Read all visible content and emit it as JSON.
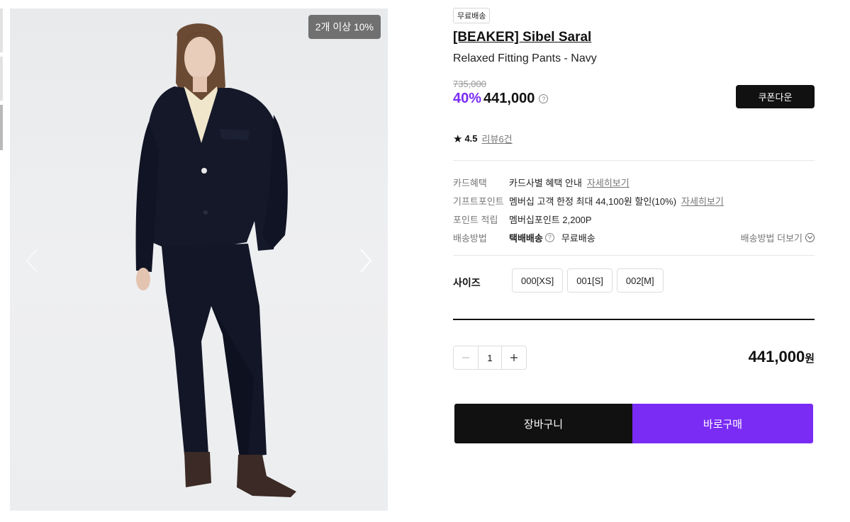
{
  "gallery": {
    "badge": "2개 이상 10%",
    "prev_icon": "chevron-left-icon",
    "next_icon": "chevron-right-icon"
  },
  "product": {
    "tag": "무료배송",
    "brand": "[BEAKER] Sibel Saral",
    "name": "Relaxed Fitting Pants - Navy",
    "original_price": "735,000",
    "discount_rate": "40%",
    "sale_price": "441,000",
    "coupon_button": "쿠폰다운",
    "rating": "4.5",
    "review_link": "리뷰6건"
  },
  "info": {
    "card": {
      "label": "카드혜택",
      "value": "카드사별 혜택 안내",
      "link": "자세히보기"
    },
    "gift": {
      "label": "기프트포인트",
      "value": "멤버십 고객 한정 최대 44,100원 할인(10%)",
      "link": "자세히보기"
    },
    "points": {
      "label": "포인트 적립",
      "value": "멤버십포인트 2,200P"
    },
    "shipping": {
      "label": "배송방법",
      "method": "택배배송",
      "fee": "무료배송",
      "more": "배송방법 더보기"
    }
  },
  "size": {
    "label": "사이즈",
    "options": [
      "000[XS]",
      "001[S]",
      "002[M]"
    ]
  },
  "quantity": {
    "value": "1"
  },
  "total": {
    "amount": "441,000",
    "unit": "원"
  },
  "actions": {
    "cart": "장바구니",
    "buy": "바로구매"
  },
  "colors": {
    "accent": "#7a2cf5",
    "dark": "#111111"
  }
}
